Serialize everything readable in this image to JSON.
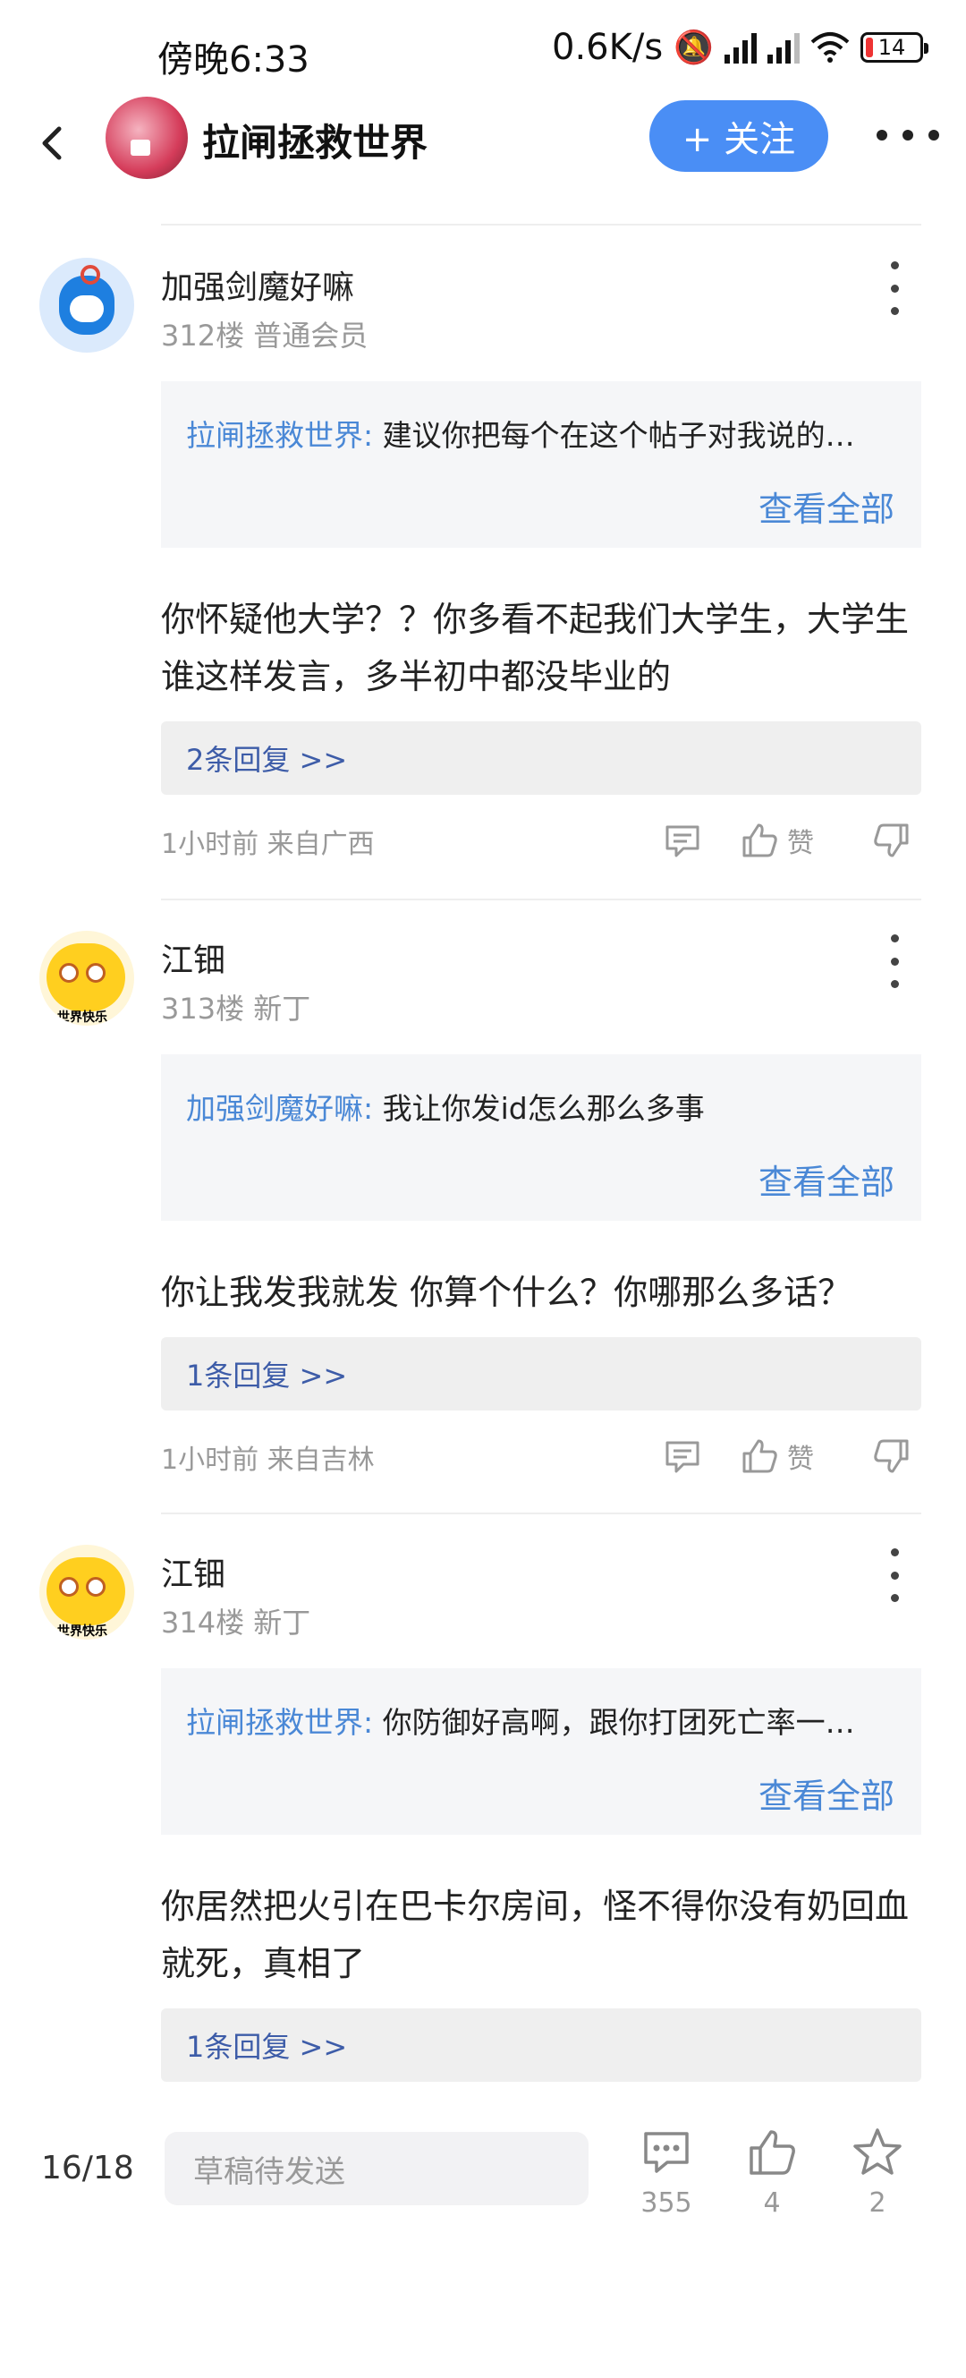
{
  "status": {
    "time": "傍晚6:33",
    "net_speed": "0.6K/s",
    "battery": "14"
  },
  "header": {
    "title": "拉闸拯救世界",
    "follow_label": "+ 关注"
  },
  "comments": [
    {
      "name": "加强剑魔好嘛",
      "floor": "312楼",
      "level": "普通会员",
      "quote_author": "拉闸拯救世界:",
      "quote_text": "建议你把每个在这个帖子对我说的…",
      "quote_more": "查看全部",
      "text": "你怀疑他大学？？你多看不起我们大学生，大学生谁这样发言，多半初中都没毕业的",
      "replies": "2条回复 >>",
      "time_loc": "1小时前 来自广西",
      "like_label": "赞"
    },
    {
      "name": "江钿",
      "floor": "313楼",
      "level": "新丁",
      "avatar_tag": "世界快乐",
      "quote_author": "加强剑魔好嘛:",
      "quote_text": "我让你发id怎么那么多事",
      "quote_more": "查看全部",
      "text": "你让我发我就发 你算个什么？你哪那么多话？",
      "replies": "1条回复 >>",
      "time_loc": "1小时前 来自吉林",
      "like_label": "赞"
    },
    {
      "name": "江钿",
      "floor": "314楼",
      "level": "新丁",
      "avatar_tag": "世界快乐",
      "quote_author": "拉闸拯救世界:",
      "quote_text": "你防御好高啊，跟你打团死亡率一…",
      "quote_more": "查看全部",
      "text": "你居然把火引在巴卡尔房间，怪不得你没有奶回血就死，真相了",
      "replies": "1条回复 >>"
    }
  ],
  "bottom": {
    "page": "16/18",
    "draft_placeholder": "草稿待发送",
    "comments_count": "355",
    "likes_count": "4",
    "stars_count": "2"
  },
  "colors": {
    "accent": "#4a8ef5",
    "link": "#4a88d6",
    "reply_link": "#3d5ca8"
  }
}
